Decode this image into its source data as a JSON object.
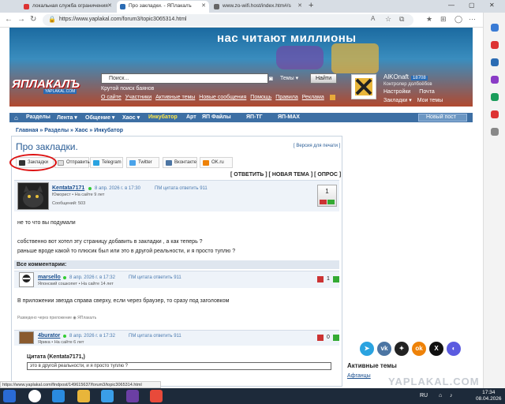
{
  "browser": {
    "tabs": [
      {
        "label": "локальная служба ограничения"
      },
      {
        "label": "Про закладки. - ЯПлакалъ"
      },
      {
        "label": "www.zo-wifi.host/index.htm#/s"
      }
    ],
    "url": "https://www.yaplakal.com/forum3/topic3065314.html",
    "status_url": "https://www.yaplakal.com/findpost/149615637/forum3/topic3065314.html"
  },
  "header": {
    "slogan": "нас читают миллионы",
    "logo": "ЯПЛАКАЛЪ",
    "logo_sub": "YAPLAKAL.COM",
    "search_placeholder": "Поиск...",
    "search_scope": "Темы",
    "search_button": "Найти",
    "links_row1": "Крутой поиск баянов",
    "links_row2": [
      "О сайте",
      "Участники",
      "Активные темы",
      "Новые сообщения",
      "Помощь",
      "Правила",
      "Реклама"
    ],
    "user": {
      "name": "AlKOnaft",
      "score": "18708",
      "title": "Контролер долбоёбов",
      "links_row1": [
        "Настройки",
        "Почта"
      ],
      "links_row2": [
        "Закладки ▾",
        "Мои темы"
      ]
    }
  },
  "nav": {
    "items": [
      "Разделы",
      "Лента ▾",
      "Общение ▾",
      "Хаос ▾",
      "Инкубатор",
      "Арт",
      "ЯП Файлы",
      "ЯП-ТГ",
      "ЯП-MAX"
    ],
    "new_post": "Новый пост"
  },
  "breadcrumb": "Главная » Разделы » Хаос » Инкубатор",
  "topic": {
    "title": "Про закладки.",
    "print_link": "[ Версия для печати ]",
    "share": [
      "Закладки",
      "Отправить",
      "Telegram",
      "Twitter",
      "Вконтакте",
      "OK.ru"
    ],
    "actions": "[ ОТВЕТИТЬ ] [ НОВАЯ ТЕМА ] [ ОПРОС ]"
  },
  "posts": [
    {
      "author": "Kentata7171",
      "date": "8 апр. 2026 г. в 17:30",
      "links": "ПМ  цитата  ответить  911",
      "rank": "Юморист",
      "since": "На сайте 9 лет",
      "messages": "Сообщений: 503",
      "rating": "1",
      "body": [
        "не то что вы подумали",
        "",
        "собственно вот хотел эту страницу добавить в закладки , а как теперь ?",
        "раньше вроде какой то плюсик был или это в другой реальности, и я просто туплю ?"
      ]
    }
  ],
  "comments_header": "Все комментарии:",
  "comments": [
    {
      "author": "marsello",
      "date": "8 апр. 2026 г. в 17:32",
      "links": "ПМ  цитата  ответить  911",
      "rank": "Японский сошкопет",
      "since": "На сайте 14 лет",
      "rating": "1",
      "body": "В приложении звезда справа сверху, если через браузер, то сразу под заголовком",
      "footer": "Разведено через приложение ◉ ЯПлакалъ"
    },
    {
      "author": "4burator",
      "date": "8 апр. 2026 г. в 17:32",
      "links": "ПМ  цитата  ответить  911",
      "rank": "Ярика",
      "since": "На сайте 6 лет",
      "rating": "0",
      "quote_head": "Цитата (Kentata7171,)",
      "quote": "это в другой реальности, и я просто туплю ?"
    }
  ],
  "sidebar": {
    "active_topics": "Активные темы",
    "active_item": "Афганцы"
  },
  "watermark": "YAPLAKAL.COM",
  "taskbar": {
    "lang": "RU",
    "time": "17:34",
    "date": "08.04.2026"
  }
}
